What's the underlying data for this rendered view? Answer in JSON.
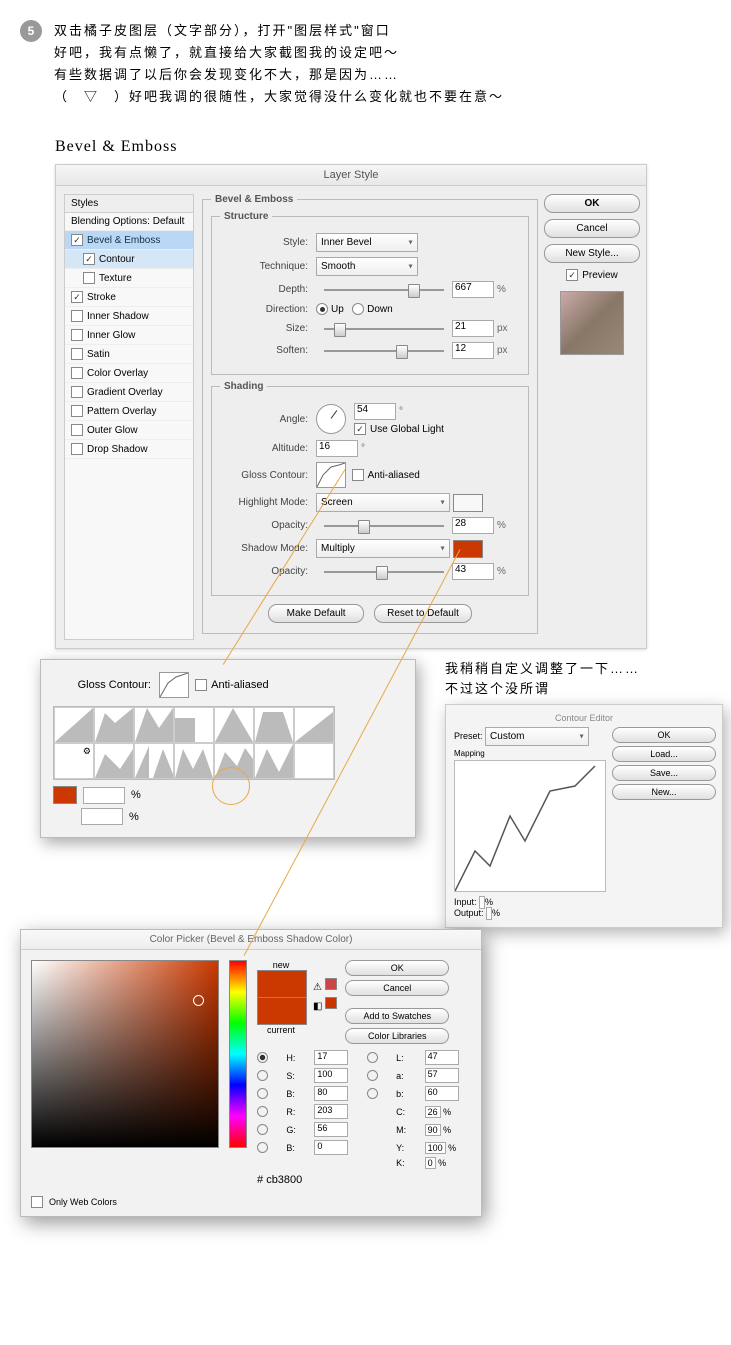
{
  "step_number": "5",
  "intro_lines": [
    "双击橘子皮图层（文字部分），打开\"图层样式\"窗口",
    "好吧，我有点懒了，就直接给大家截图我的设定吧～",
    "有些数据调了以后你会发现变化不大，那是因为……",
    "（　▽　）好吧我调的很随性，大家觉得没什么变化就也不要在意～"
  ],
  "section_title": "Bevel & Emboss",
  "dialog_title": "Layer Style",
  "styles_header": "Styles",
  "blending_header": "Blending Options: Default",
  "style_items": {
    "bevel": "Bevel & Emboss",
    "contour": "Contour",
    "texture": "Texture",
    "stroke": "Stroke",
    "inner_shadow": "Inner Shadow",
    "inner_glow": "Inner Glow",
    "satin": "Satin",
    "color_overlay": "Color Overlay",
    "gradient_overlay": "Gradient Overlay",
    "pattern_overlay": "Pattern Overlay",
    "outer_glow": "Outer Glow",
    "drop_shadow": "Drop Shadow"
  },
  "bevel": {
    "fieldset_title": "Bevel & Emboss",
    "structure_title": "Structure",
    "shading_title": "Shading",
    "style_label": "Style:",
    "style_value": "Inner Bevel",
    "technique_label": "Technique:",
    "technique_value": "Smooth",
    "depth_label": "Depth:",
    "depth_value": "667",
    "direction_label": "Direction:",
    "up": "Up",
    "down": "Down",
    "size_label": "Size:",
    "size_value": "21",
    "soften_label": "Soften:",
    "soften_value": "12",
    "angle_label": "Angle:",
    "angle_value": "54",
    "use_global": "Use Global Light",
    "altitude_label": "Altitude:",
    "altitude_value": "16",
    "gloss_label": "Gloss Contour:",
    "anti_aliased": "Anti-aliased",
    "highlight_label": "Highlight Mode:",
    "highlight_value": "Screen",
    "hl_opacity_label": "Opacity:",
    "hl_opacity_value": "28",
    "shadow_label": "Shadow Mode:",
    "shadow_value": "Multiply",
    "sh_opacity_label": "Opacity:",
    "sh_opacity_value": "43",
    "make_default": "Make Default",
    "reset_default": "Reset to Default",
    "pct": "%",
    "px": "px",
    "deg": "°"
  },
  "right_buttons": {
    "ok": "OK",
    "cancel": "Cancel",
    "new_style": "New Style...",
    "preview": "Preview"
  },
  "notes_lines": [
    "我稍稍自定义调整了一下……",
    "不过这个没所谓"
  ],
  "curve_editor": {
    "title": "Contour Editor",
    "preset_label": "Preset:",
    "preset_value": "Custom",
    "mapping": "Mapping",
    "ok": "OK",
    "load": "Load...",
    "save": "Save...",
    "new": "New...",
    "input_label": "Input:",
    "input_value": "%",
    "output_label": "Output:",
    "output_value": "%"
  },
  "picker": {
    "title": "Color Picker (Bevel & Emboss Shadow Color)",
    "new": "new",
    "current": "current",
    "ok": "OK",
    "cancel": "Cancel",
    "add_swatches": "Add to Swatches",
    "color_libraries": "Color Libraries",
    "H": "H:",
    "Hv": "17",
    "Hd": "°",
    "S": "S:",
    "Sv": "100",
    "B": "B:",
    "Bv": "80",
    "R": "R:",
    "Rv": "203",
    "G": "G:",
    "Gv": "56",
    "Bl": "B:",
    "Blv": "0",
    "L": "L:",
    "Lv": "47",
    "a": "a:",
    "av": "57",
    "b": "b:",
    "bv": "60",
    "C": "C:",
    "Cv": "26",
    "M": "M:",
    "Mv": "90",
    "Y": "Y:",
    "Yv": "100",
    "K": "K:",
    "Kv": "0",
    "pct": "%",
    "hash": "#",
    "hex": "cb3800",
    "only_web": "Only Web Colors"
  },
  "gloss_popup": {
    "label": "Gloss Contour:",
    "anti": "Anti-aliased"
  }
}
